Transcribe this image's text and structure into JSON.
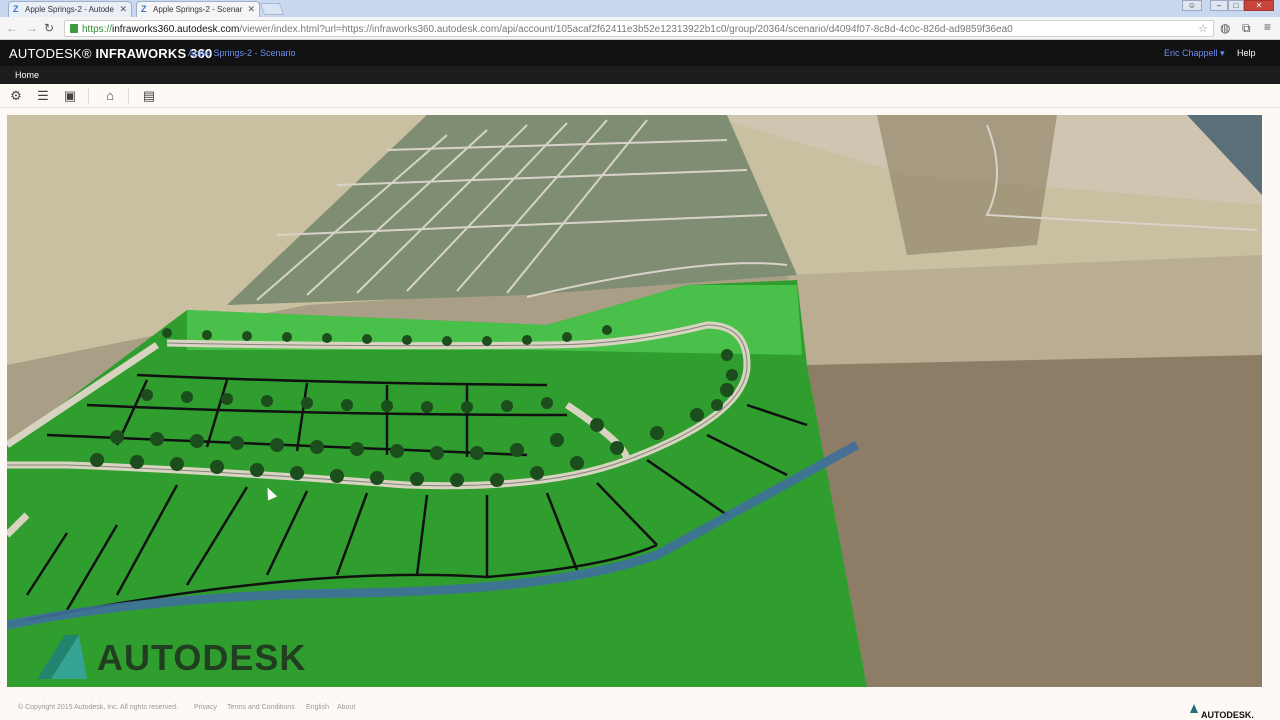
{
  "browser": {
    "tabs": [
      {
        "title": "Apple Springs-2 - Autode",
        "active": false
      },
      {
        "title": "Apple Springs-2 - Scenar",
        "active": true
      }
    ],
    "url_scheme": "https://",
    "url_host": "infraworks360.autodesk.com",
    "url_rest": "/viewer/index.html?url=https://infraworks360.autodesk.com/api/account/105acaf2f62411e3b52e12313922b1c0/group/20364/scenario/d4094f07-8c8d-4c0c-826d-ad9859f36ea0"
  },
  "app": {
    "brand_main": "AUTODESK®",
    "brand_product": "INFRAWORKS 360",
    "scenario": "Apple Springs-2 - Scenario",
    "user": "Eric Chappell",
    "help": "Help",
    "home": "Home"
  },
  "toolbar": {
    "icons": [
      "settings-icon",
      "layers-icon",
      "model-icon",
      "home-icon",
      "comments-icon"
    ]
  },
  "viewport": {
    "watermark": "AUTODESK",
    "colors": {
      "parcels": "#2f9e2f",
      "river": "#3f6f9c",
      "roads": "#d9d4c2"
    }
  },
  "footer": {
    "copyright": "© Copyright 2015 Autodesk, Inc. All rights reserved.",
    "links": [
      "Privacy",
      "Terms and Conditions",
      "English",
      "About"
    ],
    "logo": "AUTODESK."
  }
}
